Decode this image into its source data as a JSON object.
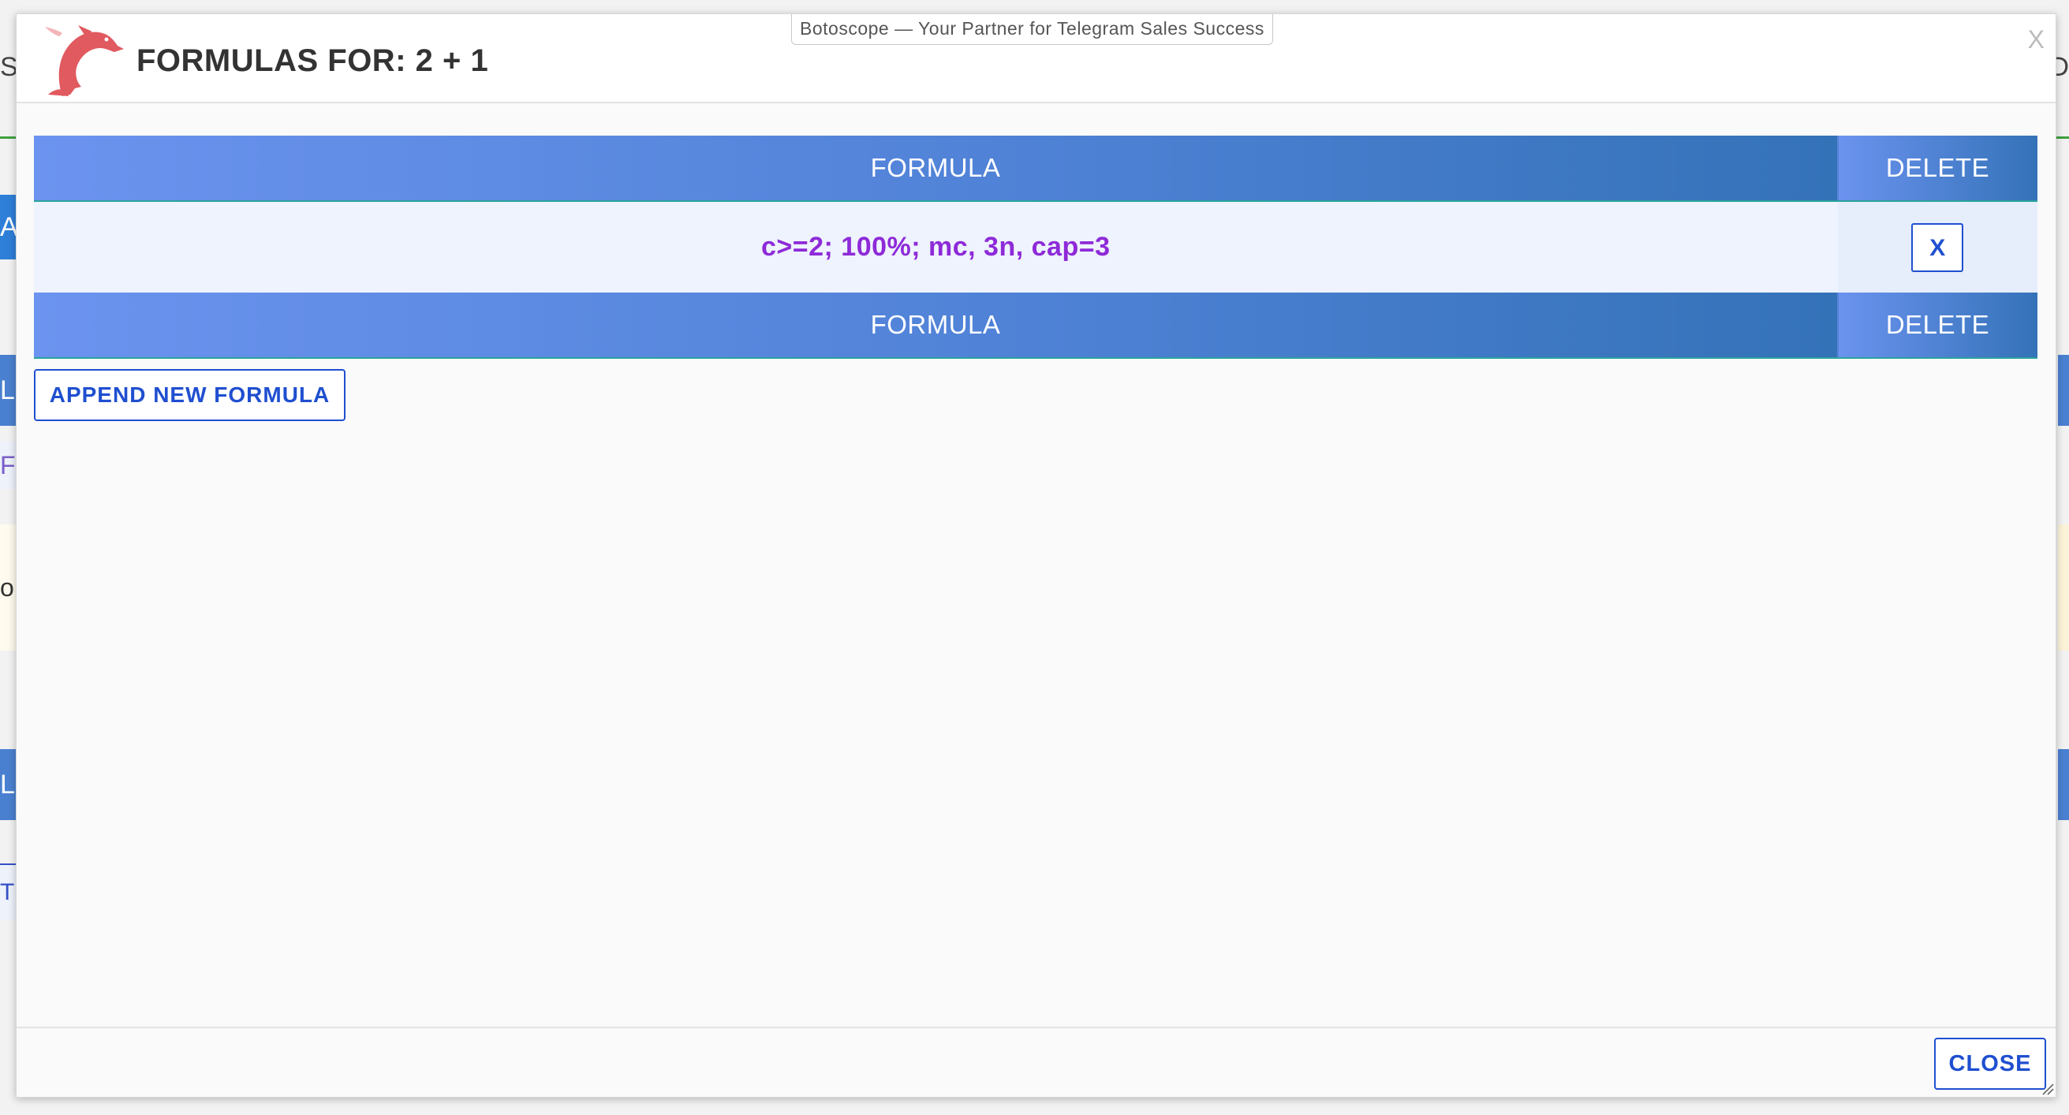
{
  "background": {
    "left_fragments": [
      "S",
      "A",
      "L",
      "Fr",
      "o",
      "L",
      "TR"
    ],
    "right_fragments": [
      "D"
    ]
  },
  "dialog": {
    "banner": "Botoscope — Your Partner for Telegram Sales Success",
    "title": "FORMULAS FOR: 2 + 1",
    "close_x": "X",
    "logo": "dolphin-logo-icon",
    "table": {
      "headers": {
        "formula": "FORMULA",
        "delete": "DELETE"
      },
      "rows": [
        {
          "formula": "c>=2; 100%; mc, 3n, cap=3",
          "delete_label": "X"
        }
      ],
      "footers": {
        "formula": "FORMULA",
        "delete": "DELETE"
      }
    },
    "append_button": "APPEND NEW FORMULA",
    "close_button": "CLOSE"
  },
  "colors": {
    "header_gradient_start": "#6b93ef",
    "header_gradient_end": "#3472b8",
    "button_blue": "#1f4fd0",
    "formula_text": "#8e2ad8",
    "logo_red": "#e05a60"
  }
}
